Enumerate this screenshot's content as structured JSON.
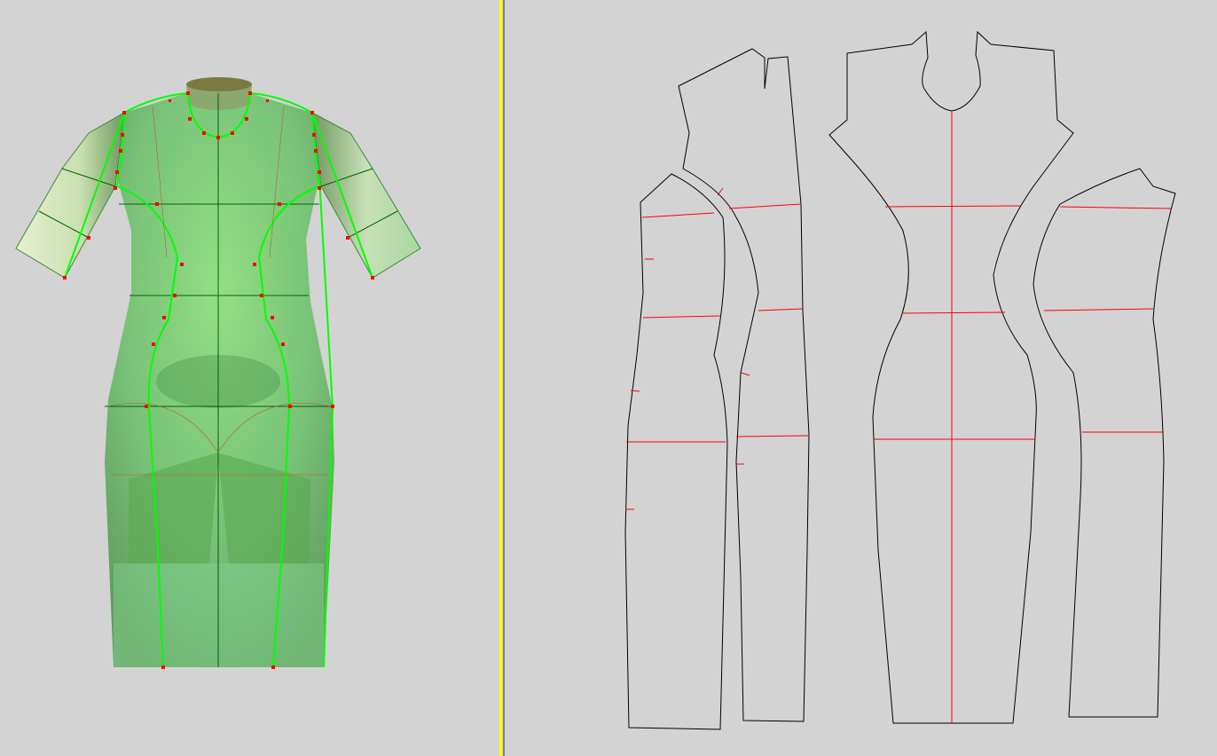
{
  "colors": {
    "background": "#d3d3d3",
    "splitter": "#ffff00",
    "garment": "#6fd36f",
    "seam_line": "#00ff00",
    "grid_line": "#006400",
    "point": "#ff0000",
    "pattern_outline": "#000000",
    "pattern_guide": "#ff0000"
  },
  "views": {
    "left": "3d-garment-viewport",
    "right": "2d-pattern-viewport"
  },
  "pattern_pieces": [
    "front-side-panel",
    "back-side-panel",
    "center-panel",
    "side-panel-right"
  ]
}
